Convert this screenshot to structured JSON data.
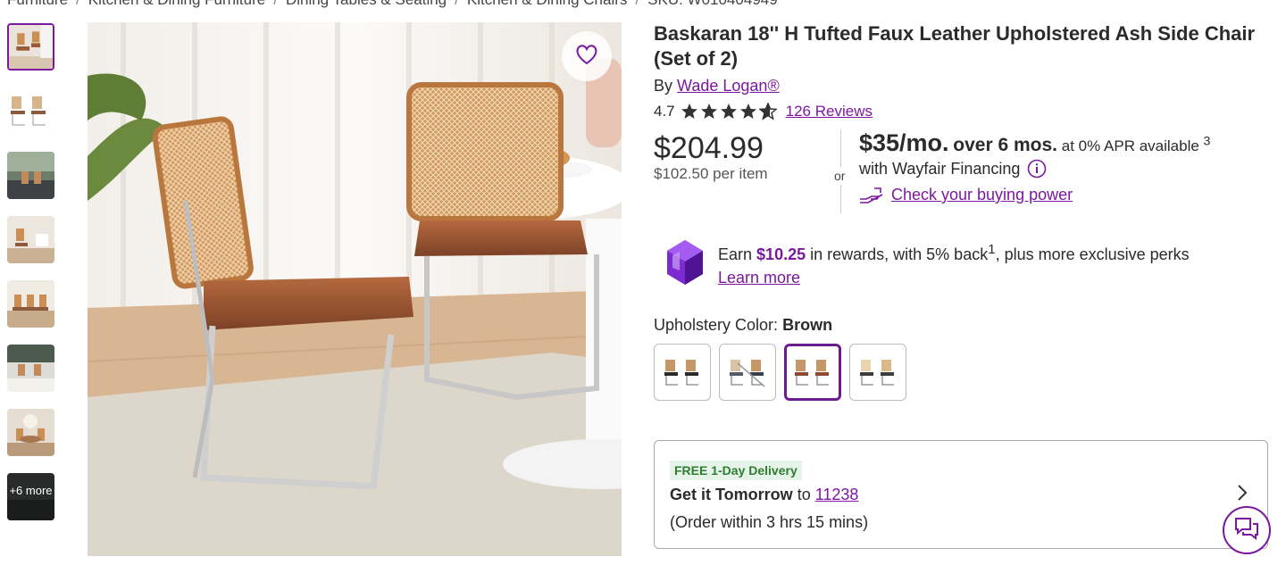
{
  "breadcrumb": [
    "Furniture",
    "Kitchen & Dining Furniture",
    "Dining Tables & Seating",
    "Kitchen & Dining Chairs",
    "SKU: W010404949"
  ],
  "thumbnails": {
    "more_label": "+6 more"
  },
  "product": {
    "title": "Baskaran 18'' H Tufted Faux Leather Upholstered Ash Side Chair (Set of 2)",
    "by_label": "By",
    "brand": "Wade Logan®",
    "rating": "4.7",
    "stars": 4.7,
    "reviews": "126 Reviews"
  },
  "pricing": {
    "price": "$204.99",
    "per_item": "$102.50 per item",
    "or": "or",
    "monthly": "$35/mo.",
    "term": "over 6 mos.",
    "apr": "at 0% APR available",
    "footnote": "3",
    "financing": "with Wayfair Financing",
    "check_power": "Check your buying power"
  },
  "rewards": {
    "earn": "Earn",
    "amount": "$10.25",
    "text": "in rewards, with 5% back",
    "footnote": "1",
    "text2": ", plus more exclusive perks",
    "learn_more": "Learn more"
  },
  "options": {
    "label": "Upholstery Color:",
    "selected": "Brown"
  },
  "delivery": {
    "badge": "FREE 1-Day Delivery",
    "get_it": "Get it Tomorrow",
    "to": "to",
    "zip": "11238",
    "order_within": "(Order within 3 hrs 15 mins)"
  },
  "colors": {
    "accent": "#7b189f",
    "free_green": "#2e7d32"
  }
}
